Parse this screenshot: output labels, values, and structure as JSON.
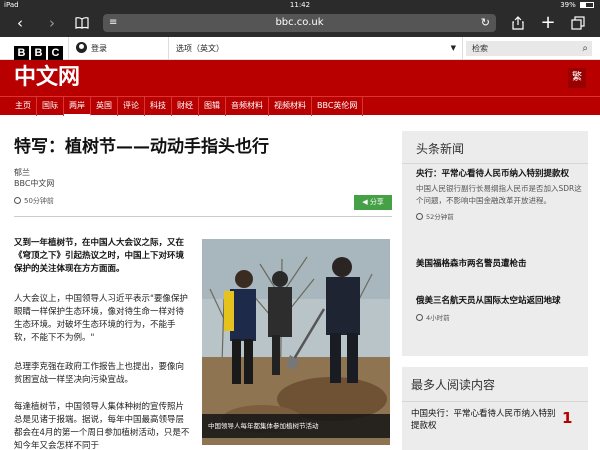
{
  "status_bar": {
    "device": "iPad",
    "time": "11:42",
    "battery": "39%",
    "battery_level": 0.39
  },
  "browser": {
    "url": "bbc.co.uk",
    "icons": [
      "back-icon",
      "forward-icon",
      "bookmarks-icon",
      "reader-icon",
      "reload-icon",
      "share-icon",
      "new-tab-icon",
      "tabs-icon"
    ]
  },
  "bbc_bar": {
    "logo": [
      "B",
      "B",
      "C"
    ],
    "login_label": "登录",
    "options_label": "选项（英文）",
    "search_label": "检索"
  },
  "header": {
    "site_title": "中文网",
    "traditional_toggle": "繁",
    "nav_items": [
      "主页",
      "国际",
      "两岸",
      "英国",
      "评论",
      "科技",
      "财经",
      "图辑",
      "音频材料",
      "视频材料",
      "BBC英伦网"
    ],
    "active_nav_index": 2
  },
  "article": {
    "title": "特写：植树节——动动手指头也行",
    "author": "郁兰",
    "organization": "BBC中文网",
    "time": "50分钟前",
    "share_label": "分享",
    "lead": "又到一年植树节，在中国人大会议之际，又在《穹顶之下》引起热议之时，中国上下对环境保护的关注体现在方方面面。",
    "paragraphs": [
      "人大会议上，中国领导人习近平表示\"要像保护眼睛一样保护生态环境，像对待生命一样对待生态环境。对破坏生态环境的行为，不能手软，不能下不为例。\"",
      "总理李克强在政府工作报告上也提出，要像向贫困宣战一样坚决向污染宣战。",
      "每逢植树节，中国领导人集体种树的宣传照片总是见诸于报端。据说，每年中国最高领导层都会在4月的第一个周日参加植树活动，只是不知今年又会怎样不同于"
    ],
    "photo_caption": "中国领导人每年都集体参加植树节活动"
  },
  "headlines": {
    "heading": "头条新闻",
    "items": [
      {
        "title": "央行：平常心看待人民币纳入特别提款权",
        "summary": "中国人民银行副行长易纲指人民币是否加入SDR这个问题，不影响中国金融改革开放进程。",
        "time": "52分钟前"
      },
      {
        "title": "美国福格森市两名警员遭枪击",
        "summary": "",
        "time": ""
      },
      {
        "title": "俄美三名航天员从国际太空站返回地球",
        "summary": "",
        "time": "4小时前"
      }
    ]
  },
  "most_read": {
    "heading": "最多人阅读内容",
    "items": [
      {
        "rank": "1",
        "title": "中国央行：平常心看待人民币纳入特别提款权"
      }
    ]
  },
  "colors": {
    "bbc_red": "#b80000",
    "share_green": "#46a046",
    "chrome": "#2b2b2b"
  }
}
